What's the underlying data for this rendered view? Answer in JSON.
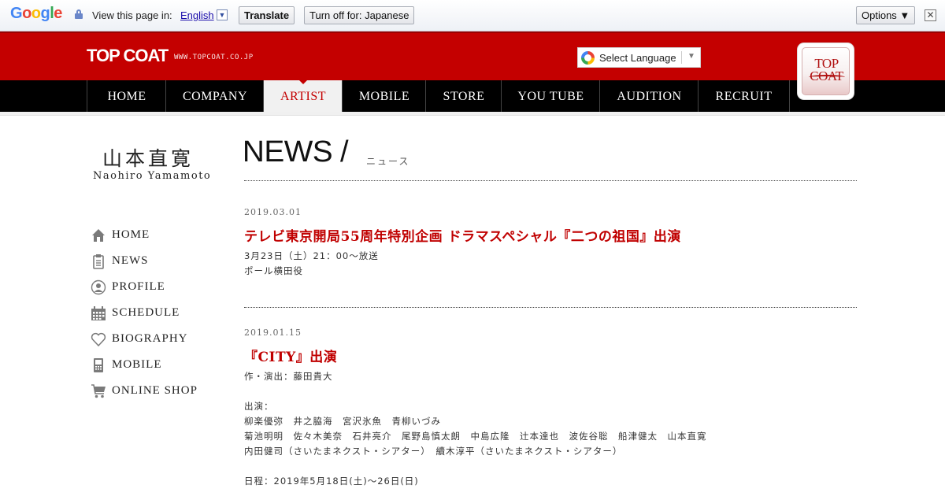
{
  "translate_bar": {
    "logo": "Google",
    "view_text": "View this page in:",
    "language": "English",
    "dropdown_glyph": "▼",
    "translate_label": "Translate",
    "turnoff_label": "Turn off for: Japanese",
    "options_label": "Options ▼",
    "close_glyph": "✕"
  },
  "header": {
    "brand": "TOP COAT",
    "brand_url": "WWW.TOPCOAT.CO.JP",
    "select_language": "Select Language",
    "select_arrow": "▼",
    "logo_line1": "TOP",
    "logo_line2": "COAT"
  },
  "nav": {
    "items": [
      "HOME",
      "COMPANY",
      "ARTIST",
      "MOBILE",
      "STORE",
      "YOU TUBE",
      "AUDITION",
      "RECRUIT"
    ],
    "active": "ARTIST"
  },
  "artist": {
    "name_jp": "山本直寛",
    "name_en": "Naohiro Yamamoto"
  },
  "sidebar": {
    "items": [
      {
        "label": "HOME",
        "icon": "house-icon"
      },
      {
        "label": "NEWS",
        "icon": "clipboard-icon"
      },
      {
        "label": "PROFILE",
        "icon": "person-icon"
      },
      {
        "label": "SCHEDULE",
        "icon": "calendar-icon"
      },
      {
        "label": "BIOGRAPHY",
        "icon": "heart-icon"
      },
      {
        "label": "MOBILE",
        "icon": "phone-icon"
      },
      {
        "label": "ONLINE SHOP",
        "icon": "cart-icon"
      }
    ]
  },
  "page": {
    "title": "NEWS",
    "slash": "/",
    "subtitle": "ニュース"
  },
  "news": [
    {
      "date": "2019.03.01",
      "headline": "テレビ東京開局55周年特別企画 ドラマスペシャル『二つの祖国』出演",
      "lines": [
        "3月23日（土）21：00～放送",
        "ポール横田役"
      ]
    },
    {
      "date": "2019.01.15",
      "headline": "『CITY』出演",
      "lines": [
        "作・演出：藤田貴大",
        "",
        "出演：",
        "柳楽優弥　井之脇海　宮沢氷魚　青柳いづみ",
        "菊池明明　佐々木美奈　石井亮介　尾野島慎太朗　中島広隆　辻本達也　波佐谷聡　船津健太　山本直寛",
        "内田健司（さいたまネクスト・シアター）　續木淳平（さいたまネクスト・シアター）",
        "",
        "日程：2019年5月18日(土)～26日(日)"
      ]
    }
  ],
  "colors": {
    "header_red": "#c40000",
    "headline_red": "#c00000",
    "nav_black": "#000000"
  }
}
